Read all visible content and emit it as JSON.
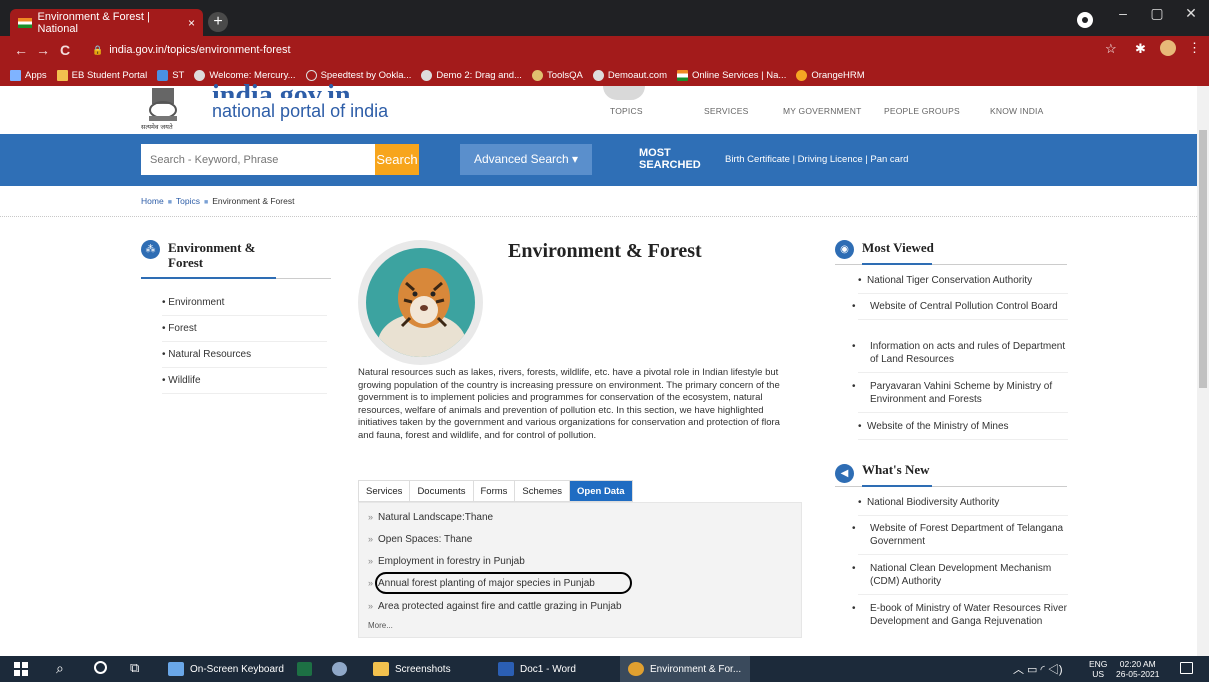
{
  "browser": {
    "tab_title": "Environment & Forest | National",
    "tab_close": "×",
    "new_tab": "+",
    "url": "india.gov.in/topics/environment-forest",
    "nav_back": "←",
    "nav_forward": "→",
    "nav_reload": "C",
    "bookmarks": [
      "Apps",
      "EB Student Portal",
      "ST",
      "Welcome: Mercury...",
      "Speedtest by Ookla...",
      "Demo 2: Drag and...",
      "ToolsQA",
      "Demoaut.com",
      "Online Services | Na...",
      "OrangeHRM"
    ],
    "accent_color": "#a31b1b"
  },
  "site": {
    "logo_big": "india.gov.in",
    "logo_sub": "national portal of india",
    "emblem_caption": "सत्यमेव जयते",
    "topnav": [
      "TOPICS",
      "SERVICES",
      "MY GOVERNMENT",
      "PEOPLE GROUPS",
      "KNOW INDIA"
    ],
    "search_placeholder": "Search - Keyword, Phrase",
    "search_button": "Search",
    "advanced_search": "Advanced Search ▾",
    "most_searched_1": "MOST",
    "most_searched_2": "SEARCHED",
    "quicklinks": "Birth Certificate  |  Driving Licence  |  Pan card"
  },
  "breadcrumb": [
    "Home",
    "Topics",
    "Environment & Forest"
  ],
  "left": {
    "title": "Environment & Forest",
    "items": [
      "Environment",
      "Forest",
      "Natural Resources",
      "Wildlife"
    ]
  },
  "main": {
    "title": "Environment & Forest",
    "intro": "Natural resources such as lakes, rivers, forests, wildlife, etc. have a pivotal role in Indian lifestyle but growing population of the country is increasing pressure on environment. The primary concern of the government is to implement policies and programmes for conservation of the ecosystem, natural resources, welfare of animals and prevention of pollution etc. In this section, we have highlighted initiatives taken by the government and various organizations for conservation and protection of flora and fauna, forest and wildlife, and for control of pollution.",
    "tabs": [
      "Services",
      "Documents",
      "Forms",
      "Schemes",
      "Open Data"
    ],
    "active_tab": "Open Data",
    "open_data": [
      "Natural Landscape:Thane",
      "Open Spaces: Thane",
      "Employment in forestry in Punjab",
      "Annual forest planting of major species in Punjab",
      "Area protected against fire and cattle grazing in Punjab"
    ],
    "more": "More..."
  },
  "right": {
    "most_viewed_title": "Most Viewed",
    "most_viewed": [
      "National Tiger Conservation Authority",
      "Website of Central Pollution Control Board",
      "Information on acts and rules of Department of Land Resources",
      "Paryavaran Vahini Scheme by Ministry of Environment and Forests",
      "Website of the Ministry of Mines"
    ],
    "whats_new_title": "What's New",
    "whats_new": [
      "National Biodiversity Authority",
      "Website of Forest Department of Telangana Government",
      "National Clean Development Mechanism (CDM) Authority",
      "E-book of Ministry of Water Resources River Development and Ganga Rejuvenation"
    ]
  },
  "taskbar": {
    "items": [
      "On-Screen Keyboard",
      "Screenshots",
      "Doc1 - Word",
      "Environment & For..."
    ],
    "lang1": "ENG",
    "lang2": "US",
    "time": "02:20 AM",
    "date": "26-05-2021"
  }
}
